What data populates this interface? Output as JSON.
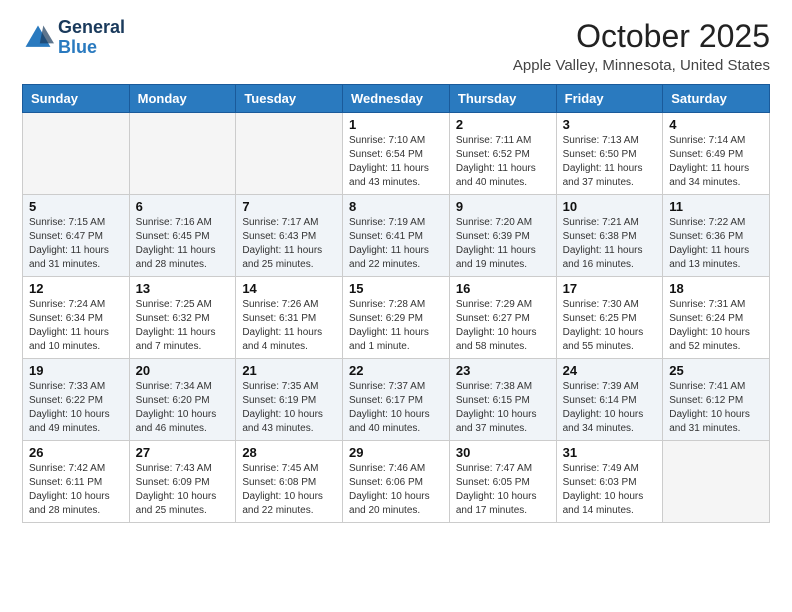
{
  "logo": {
    "line1": "General",
    "line2": "Blue"
  },
  "title": "October 2025",
  "subtitle": "Apple Valley, Minnesota, United States",
  "headers": [
    "Sunday",
    "Monday",
    "Tuesday",
    "Wednesday",
    "Thursday",
    "Friday",
    "Saturday"
  ],
  "weeks": [
    [
      {
        "day": "",
        "info": ""
      },
      {
        "day": "",
        "info": ""
      },
      {
        "day": "",
        "info": ""
      },
      {
        "day": "1",
        "info": "Sunrise: 7:10 AM\nSunset: 6:54 PM\nDaylight: 11 hours and 43 minutes."
      },
      {
        "day": "2",
        "info": "Sunrise: 7:11 AM\nSunset: 6:52 PM\nDaylight: 11 hours and 40 minutes."
      },
      {
        "day": "3",
        "info": "Sunrise: 7:13 AM\nSunset: 6:50 PM\nDaylight: 11 hours and 37 minutes."
      },
      {
        "day": "4",
        "info": "Sunrise: 7:14 AM\nSunset: 6:49 PM\nDaylight: 11 hours and 34 minutes."
      }
    ],
    [
      {
        "day": "5",
        "info": "Sunrise: 7:15 AM\nSunset: 6:47 PM\nDaylight: 11 hours and 31 minutes."
      },
      {
        "day": "6",
        "info": "Sunrise: 7:16 AM\nSunset: 6:45 PM\nDaylight: 11 hours and 28 minutes."
      },
      {
        "day": "7",
        "info": "Sunrise: 7:17 AM\nSunset: 6:43 PM\nDaylight: 11 hours and 25 minutes."
      },
      {
        "day": "8",
        "info": "Sunrise: 7:19 AM\nSunset: 6:41 PM\nDaylight: 11 hours and 22 minutes."
      },
      {
        "day": "9",
        "info": "Sunrise: 7:20 AM\nSunset: 6:39 PM\nDaylight: 11 hours and 19 minutes."
      },
      {
        "day": "10",
        "info": "Sunrise: 7:21 AM\nSunset: 6:38 PM\nDaylight: 11 hours and 16 minutes."
      },
      {
        "day": "11",
        "info": "Sunrise: 7:22 AM\nSunset: 6:36 PM\nDaylight: 11 hours and 13 minutes."
      }
    ],
    [
      {
        "day": "12",
        "info": "Sunrise: 7:24 AM\nSunset: 6:34 PM\nDaylight: 11 hours and 10 minutes."
      },
      {
        "day": "13",
        "info": "Sunrise: 7:25 AM\nSunset: 6:32 PM\nDaylight: 11 hours and 7 minutes."
      },
      {
        "day": "14",
        "info": "Sunrise: 7:26 AM\nSunset: 6:31 PM\nDaylight: 11 hours and 4 minutes."
      },
      {
        "day": "15",
        "info": "Sunrise: 7:28 AM\nSunset: 6:29 PM\nDaylight: 11 hours and 1 minute."
      },
      {
        "day": "16",
        "info": "Sunrise: 7:29 AM\nSunset: 6:27 PM\nDaylight: 10 hours and 58 minutes."
      },
      {
        "day": "17",
        "info": "Sunrise: 7:30 AM\nSunset: 6:25 PM\nDaylight: 10 hours and 55 minutes."
      },
      {
        "day": "18",
        "info": "Sunrise: 7:31 AM\nSunset: 6:24 PM\nDaylight: 10 hours and 52 minutes."
      }
    ],
    [
      {
        "day": "19",
        "info": "Sunrise: 7:33 AM\nSunset: 6:22 PM\nDaylight: 10 hours and 49 minutes."
      },
      {
        "day": "20",
        "info": "Sunrise: 7:34 AM\nSunset: 6:20 PM\nDaylight: 10 hours and 46 minutes."
      },
      {
        "day": "21",
        "info": "Sunrise: 7:35 AM\nSunset: 6:19 PM\nDaylight: 10 hours and 43 minutes."
      },
      {
        "day": "22",
        "info": "Sunrise: 7:37 AM\nSunset: 6:17 PM\nDaylight: 10 hours and 40 minutes."
      },
      {
        "day": "23",
        "info": "Sunrise: 7:38 AM\nSunset: 6:15 PM\nDaylight: 10 hours and 37 minutes."
      },
      {
        "day": "24",
        "info": "Sunrise: 7:39 AM\nSunset: 6:14 PM\nDaylight: 10 hours and 34 minutes."
      },
      {
        "day": "25",
        "info": "Sunrise: 7:41 AM\nSunset: 6:12 PM\nDaylight: 10 hours and 31 minutes."
      }
    ],
    [
      {
        "day": "26",
        "info": "Sunrise: 7:42 AM\nSunset: 6:11 PM\nDaylight: 10 hours and 28 minutes."
      },
      {
        "day": "27",
        "info": "Sunrise: 7:43 AM\nSunset: 6:09 PM\nDaylight: 10 hours and 25 minutes."
      },
      {
        "day": "28",
        "info": "Sunrise: 7:45 AM\nSunset: 6:08 PM\nDaylight: 10 hours and 22 minutes."
      },
      {
        "day": "29",
        "info": "Sunrise: 7:46 AM\nSunset: 6:06 PM\nDaylight: 10 hours and 20 minutes."
      },
      {
        "day": "30",
        "info": "Sunrise: 7:47 AM\nSunset: 6:05 PM\nDaylight: 10 hours and 17 minutes."
      },
      {
        "day": "31",
        "info": "Sunrise: 7:49 AM\nSunset: 6:03 PM\nDaylight: 10 hours and 14 minutes."
      },
      {
        "day": "",
        "info": ""
      }
    ]
  ]
}
